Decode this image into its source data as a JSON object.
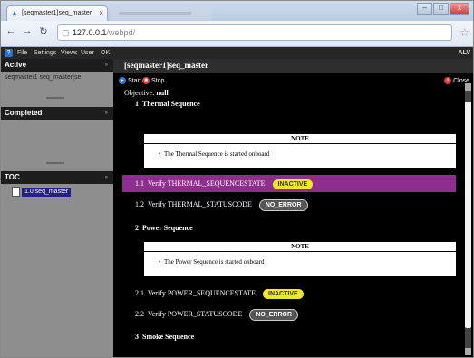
{
  "browser": {
    "tab_title": "[seqmaster1]seq_master",
    "tab_close": "×",
    "url_host": "127.0.0.1",
    "url_path": "/webpd/",
    "window_buttons": [
      "–",
      "□",
      "x"
    ]
  },
  "menubar": {
    "items": [
      "File",
      "Settings",
      "Views",
      "User",
      "OK"
    ],
    "right": "ALV"
  },
  "sidebar": {
    "active_label": "Active",
    "active_item": "seqmaster1 seq_master[se",
    "completed_label": "Completed",
    "toc_label": "TOC",
    "toc_item": "1.0 seq_master"
  },
  "main": {
    "title": "[seqmaster1]seq_master",
    "start_label": "Start",
    "stop_label": "Stop",
    "close_label": "Close",
    "objective_label": "Objective:",
    "objective_value": "null",
    "sections": [
      {
        "num": "1",
        "title": "Thermal Sequence"
      },
      {
        "num": "2",
        "title": "Power Sequence"
      },
      {
        "num": "3",
        "title": "Smoke Sequence"
      }
    ],
    "notes": [
      {
        "head": "NOTE",
        "text": "The Thermal Sequence is started onboard"
      },
      {
        "head": "NOTE",
        "text": "The Power Sequence is started onboard"
      }
    ],
    "steps": [
      {
        "num": "1.1",
        "text": "Verify THERMAL_SEQUENCESTATE",
        "status": "INACTIVE"
      },
      {
        "num": "1.2",
        "text": "Verify THERMAL_STATUSCODE",
        "status": "NO_ERROR"
      },
      {
        "num": "2.1",
        "text": "Verify POWER_SEQUENCESTATE",
        "status": "INACTIVE"
      },
      {
        "num": "2.2",
        "text": "Verify POWER_STATUSCODE",
        "status": "NO_ERROR"
      }
    ]
  },
  "colors": {
    "highlight_row": "#8e2f8f",
    "inactive_badge": "#f0e62a",
    "ok_badge": "#555555",
    "toc_selected": "#23237a"
  }
}
